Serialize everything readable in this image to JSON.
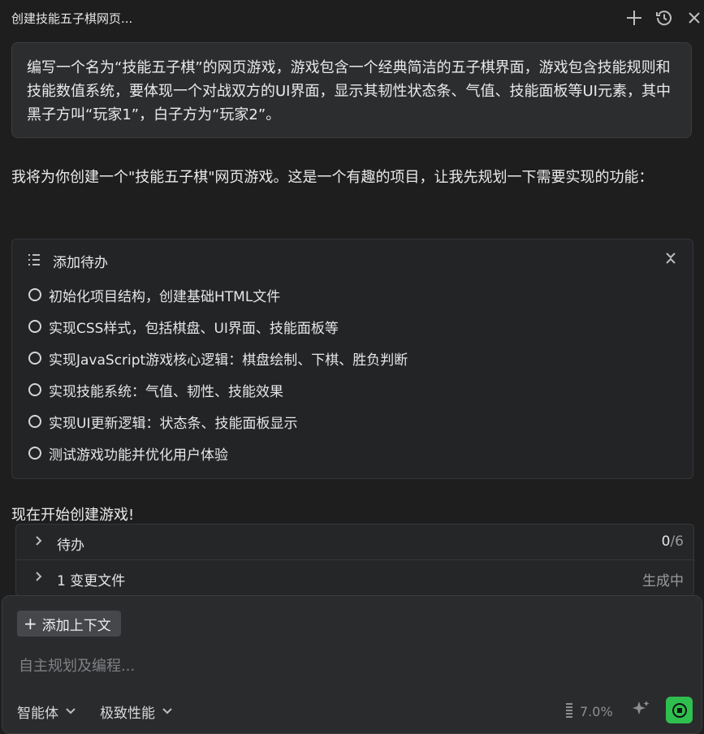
{
  "header": {
    "title": "创建技能五子棋网页...",
    "icons": [
      "plus-icon",
      "history-icon",
      "close-icon"
    ]
  },
  "prompt": {
    "text": "编写一个名为“技能五子棋”的网页游戏，游戏包含一个经典简洁的五子棋界面，游戏包含技能规则和技能数值系统，要体现一个对战双方的UI界面，显示其韧性状态条、气值、技能面板等UI元素，其中黑子方叫“玩家1”，白子方为“玩家2”。"
  },
  "reply": {
    "text": "我将为你创建一个\"技能五子棋\"网页游戏。这是一个有趣的项目，让我先规划一下需要实现的功能："
  },
  "todo_card": {
    "title": "添加待办",
    "items": [
      "初始化项目结构，创建基础HTML文件",
      "实现CSS样式，包括棋盘、UI界面、技能面板等",
      "实现JavaScript游戏核心逻辑：棋盘绘制、下棋、胜负判断",
      "实现技能系统：气值、韧性、技能效果",
      "实现UI更新逻辑：状态条、技能面板显示",
      "测试游戏功能并优化用户体验"
    ]
  },
  "start_text": "现在开始创建游戏!",
  "collapsibles": {
    "todos": {
      "label": "待办",
      "done": "0",
      "total": "/6"
    },
    "files": {
      "label": "1 变更文件",
      "status": "生成中"
    }
  },
  "composer": {
    "add_context_label": "添加上下文",
    "placeholder": "自主规划及编程...",
    "agent_select": "智能体",
    "mode_select": "极致性能",
    "usage": "7.0%"
  },
  "colors": {
    "background": "#1e1e1f",
    "card": "#2b2d2f",
    "accent_send": "#2fbf4f"
  }
}
